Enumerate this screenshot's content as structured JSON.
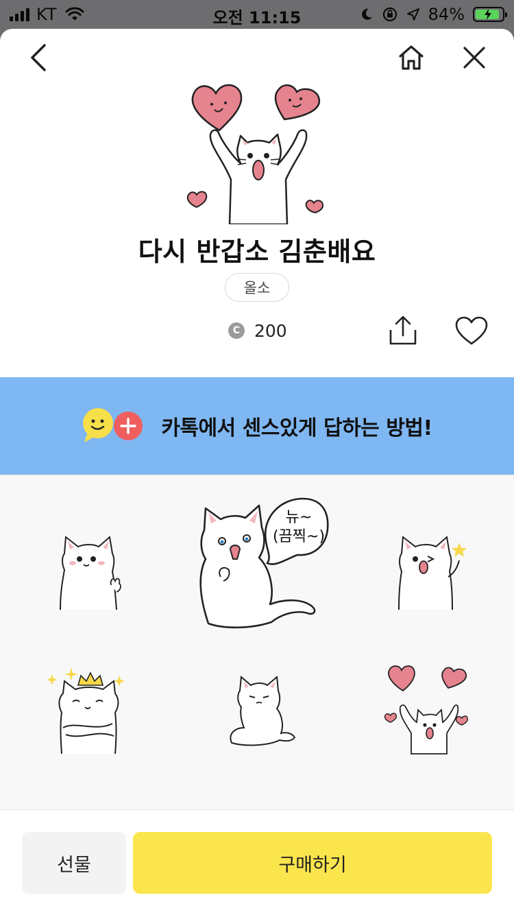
{
  "status_bar": {
    "carrier": "KT",
    "time": "오전 11:15",
    "battery_percent": "84%"
  },
  "product": {
    "title": "다시 반갑소 김춘배요",
    "author": "올소",
    "price": "200",
    "currency_symbol": "C"
  },
  "banner": {
    "text": "카톡에서 센스있게 답하는 방법!"
  },
  "preview": {
    "speech_line1": "뉴~",
    "speech_line2": "(끔찍~)"
  },
  "actions": {
    "gift_label": "선물",
    "buy_label": "구매하기"
  },
  "colors": {
    "banner_bg": "#7fb7f2",
    "buy_button": "#fbe54d",
    "heart_pink": "#e5838f",
    "add_button_red": "#ef5f5f",
    "emoticon_yellow": "#f7df4a"
  }
}
